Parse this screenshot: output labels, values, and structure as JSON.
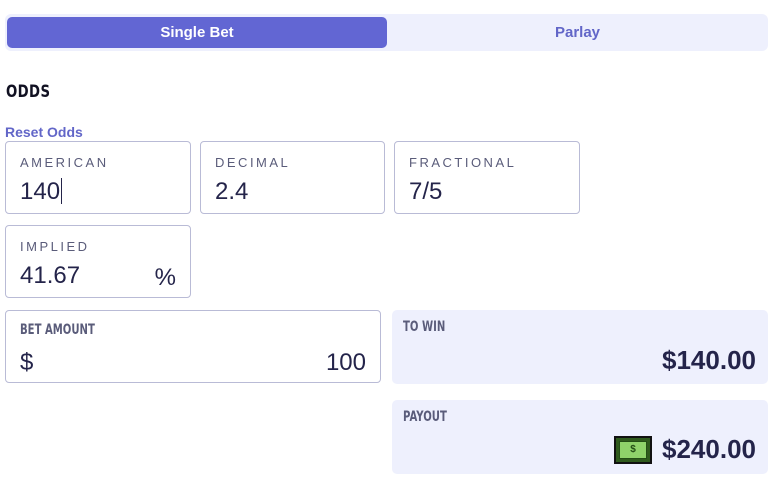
{
  "tabs": {
    "single": "Single Bet",
    "parlay": "Parlay"
  },
  "odds": {
    "title": "ODDS",
    "reset_label": "Reset Odds",
    "american": {
      "label": "AMERICAN",
      "value": "140"
    },
    "decimal": {
      "label": "DECIMAL",
      "value": "2.4"
    },
    "fractional": {
      "label": "FRACTIONAL",
      "value": "7/5"
    },
    "implied": {
      "label": "IMPLIED",
      "value": "41.67",
      "unit": "%"
    }
  },
  "bet": {
    "label": "BET AMOUNT",
    "currency": "$",
    "value": "100"
  },
  "to_win": {
    "label": "TO WIN",
    "value": "$140.00"
  },
  "payout": {
    "label": "PAYOUT",
    "value": "$240.00",
    "icon": "money-icon"
  },
  "colors": {
    "accent": "#6266d3",
    "panel": "#eef0fd",
    "text": "#24244a"
  }
}
